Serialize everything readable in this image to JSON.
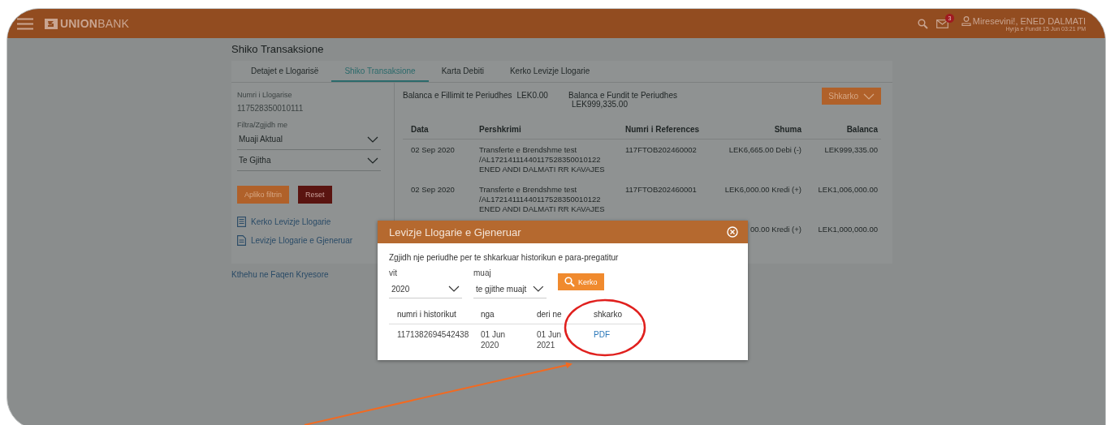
{
  "header": {
    "logo": "**UNION**BANK",
    "notification_count": "3",
    "greeting": "Miresevini!, ENED DALMATI",
    "last_login": "Hyrja e Fundit 15 Jun 03:21 PM"
  },
  "page_title": "Shiko Transaksione",
  "tabs": [
    {
      "label": "Detajet e Llogarisë",
      "selected": false
    },
    {
      "label": "Shiko Transaksione",
      "selected": true
    },
    {
      "label": "Karta Debiti",
      "selected": false
    },
    {
      "label": "Kerko Levizje Llogarie",
      "selected": false
    }
  ],
  "account": {
    "label": "Numri i Llogarise",
    "number": "117528350010111"
  },
  "filter": {
    "label": "Filtra/Zgjidh me",
    "selects": [
      "Muaji Aktual",
      "Te Gjitha"
    ]
  },
  "filter_buttons": [
    {
      "label": "Apliko filtrin",
      "kind": "apply"
    },
    {
      "label": "Reset",
      "kind": "reset"
    }
  ],
  "side_links": [
    {
      "label": "Kerko Levizje Llogarie",
      "kind": "list"
    },
    {
      "label": "Levizje Llogarie e Gjeneruar",
      "kind": "document"
    }
  ],
  "back_link": "Kthehu ne Faqen Kryesore",
  "balances": {
    "opening_label": "Balanca e Fillimit te Periudhes",
    "opening_value": "LEK0.00",
    "closing_label": "Balanca e Fundit te Periudhes",
    "closing_value": "LEK999,335.00"
  },
  "download_button": "Shkarko",
  "table": {
    "columns": [
      "Data",
      "Pershkrimi",
      "Numri i References",
      "Shuma",
      "Balanca"
    ],
    "rows": [
      {
        "date": "02 Sep 2020",
        "description": [
          "Transferte e Brendshme test",
          "/AL17214111440117528350010122",
          "ENED ANDI DALMATI RR KAVAJES"
        ],
        "reference": "117FTOB202460002",
        "amount": "LEK6,665.00 Debi (-)",
        "balance": "LEK999,335.00"
      },
      {
        "date": "02 Sep 2020",
        "description": [
          "Transferte e Brendshme test",
          "/AL17214111440117528350010122",
          "ENED ANDI DALMATI RR KAVAJES"
        ],
        "reference": "117FTOB202460001",
        "amount": "LEK6,000.00 Kredi (+)",
        "balance": "LEK1,006,000.00"
      },
      {
        "amount": "00.00 Kredi (+)",
        "balance": "LEK1,000,000.00"
      }
    ]
  },
  "modal": {
    "title": "Levizje Llogarie e Gjeneruar",
    "instruction": "Zgjidh nje periudhe per te shkarkuar historikun e para-pregatitur",
    "fields": [
      {
        "label": "vit",
        "value": "2020"
      },
      {
        "label": "muaj",
        "value": "te gjithe muajt"
      }
    ],
    "search_button": "Kerko",
    "columns": [
      "numri i historikut",
      "nga",
      "deri ne",
      "shkarko"
    ],
    "rows": [
      {
        "number": "1171382694542438",
        "from": "01 Jun 2020",
        "to": "01 Jun 2021",
        "download": "PDF"
      }
    ]
  }
}
